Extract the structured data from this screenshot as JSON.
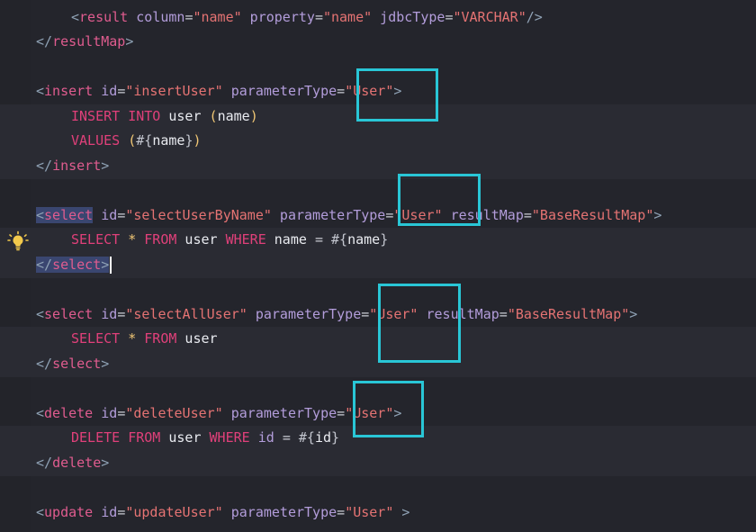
{
  "code": {
    "result_line": {
      "open_br": "<",
      "tag": "result",
      "a1": " column",
      "eq1": "=",
      "v1": "\"name\"",
      "a2": " property",
      "eq2": "=",
      "v2": "\"name\"",
      "a3": " jdbcType",
      "eq3": "=",
      "v3": "\"VARCHAR\"",
      "close_br": "/>"
    },
    "resultmap_close": {
      "open_br": "</",
      "tag": "resultMap",
      "close_br": ">"
    },
    "insert": {
      "open_br": "<",
      "tag": "insert",
      "a1": " id",
      "eq1": "=",
      "v1": "\"insertUser\"",
      "a2": " parameterType",
      "eq2": "=",
      "v2": "\"User\"",
      "close_br": ">",
      "sql1_kw": "INSERT INTO",
      "sql1_tbl": " user ",
      "sql1_p1": "(",
      "sql1_col": "name",
      "sql1_p2": ")",
      "sql2_kw": "VALUES",
      "sql2_p1": " (",
      "sql2_ph1": "#{",
      "sql2_col": "name",
      "sql2_ph2": "}",
      "sql2_p2": ")",
      "end_br1": "</",
      "end_tag": "insert",
      "end_br2": ">"
    },
    "select_by_name": {
      "open_br": "<",
      "tag": "select",
      "a1": " id",
      "eq1": "=",
      "v1": "\"selectUserByName\"",
      "a2": " parameterType",
      "eq2": "=",
      "v2": "\"User\"",
      "a3": " resultMap",
      "eq3": "=",
      "v3": "\"BaseResultMap\"",
      "close_br": ">",
      "sql_k1": "SELECT",
      "sql_star": " * ",
      "sql_k2": "FROM",
      "sql_tbl": " user ",
      "sql_k3": "WHERE",
      "sql_col": " name ",
      "sql_op": "=",
      "sql_ph1": " #{",
      "sql_val": "name",
      "sql_ph2": "}",
      "end_br1": "</",
      "end_tag": "select",
      "end_br2": ">"
    },
    "select_all": {
      "open_br": "<",
      "tag": "select",
      "a1": " id",
      "eq1": "=",
      "v1": "\"selectAllUser\"",
      "a2": " parameterType",
      "eq2": "=",
      "v2": "\"User\"",
      "a3": " resultMap",
      "eq3": "=",
      "v3": "\"BaseResultMap\"",
      "close_br": ">",
      "sql_k1": "SELECT",
      "sql_star": " * ",
      "sql_k2": "FROM",
      "sql_tbl": " user",
      "end_br1": "</",
      "end_tag": "select",
      "end_br2": ">"
    },
    "delete": {
      "open_br": "<",
      "tag": "delete",
      "a1": " id",
      "eq1": "=",
      "v1": "\"deleteUser\"",
      "a2": " parameterType",
      "eq2": "=",
      "v2": "\"User\"",
      "close_br": ">",
      "sql_k1": "DELETE",
      "sql_sp": " ",
      "sql_k2": "FROM",
      "sql_tbl": " user ",
      "sql_k3": "WHERE",
      "sql_col": " id ",
      "sql_op": "=",
      "sql_ph1": " #{",
      "sql_val": "id",
      "sql_ph2": "}",
      "end_br1": "</",
      "end_tag": "delete",
      "end_br2": ">"
    },
    "update": {
      "open_br": "<",
      "tag": "update",
      "a1": " id",
      "eq1": "=",
      "v1": "\"updateUser\"",
      "a2": " parameterType",
      "eq2": "=",
      "v2": "\"User\"",
      "close_br": " >"
    }
  },
  "gutter_icons": [
    "lightbulb-icon"
  ],
  "highlight_color": "#29c6d6"
}
